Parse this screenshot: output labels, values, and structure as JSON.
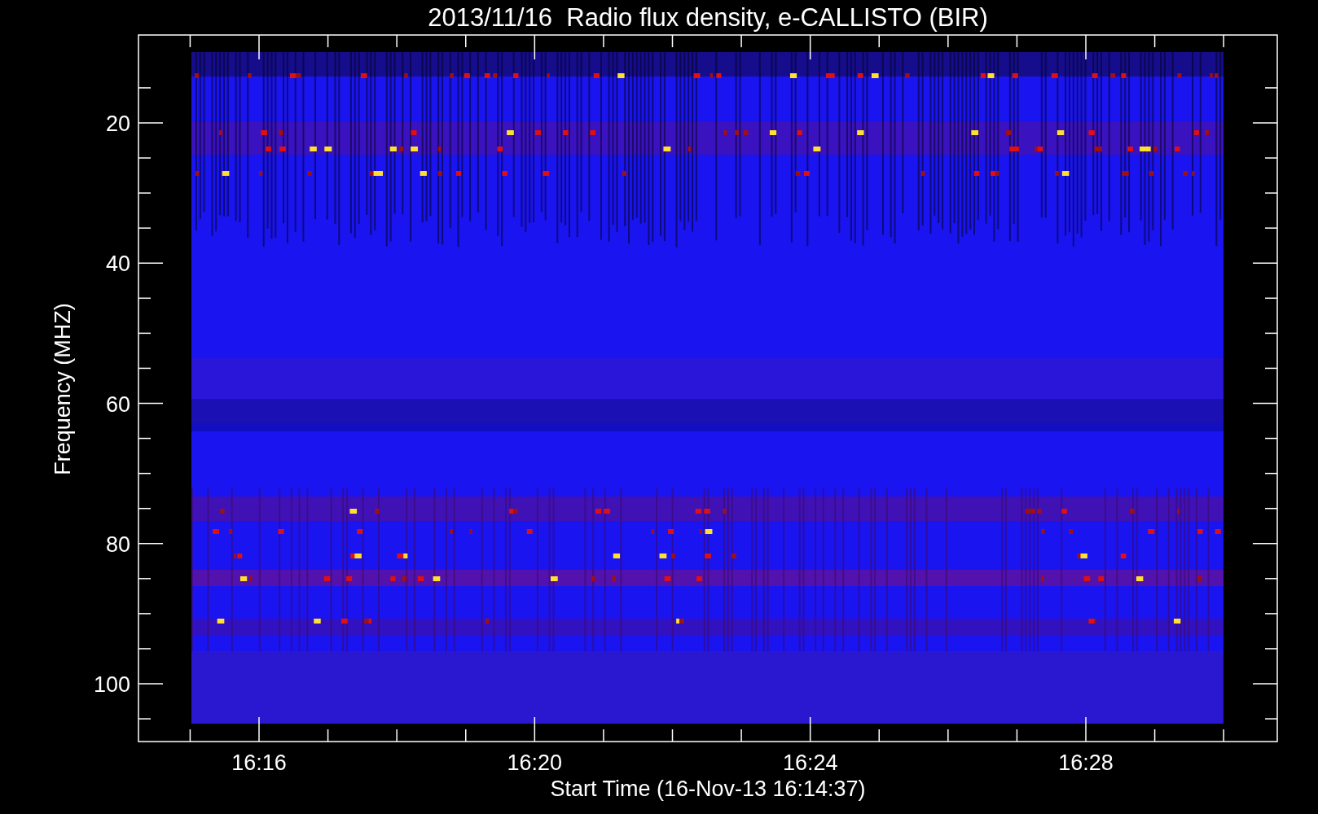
{
  "title": "2013/11/16  Radio flux density, e-CALLISTO (BIR)",
  "y_axis": {
    "label": "Frequency (MHZ)",
    "ticks": [
      "20",
      "40",
      "60",
      "80",
      "100"
    ]
  },
  "x_axis": {
    "label": "Start Time (16-Nov-13 16:14:37)",
    "ticks": [
      "16:16",
      "16:20",
      "16:24",
      "16:28"
    ]
  }
}
